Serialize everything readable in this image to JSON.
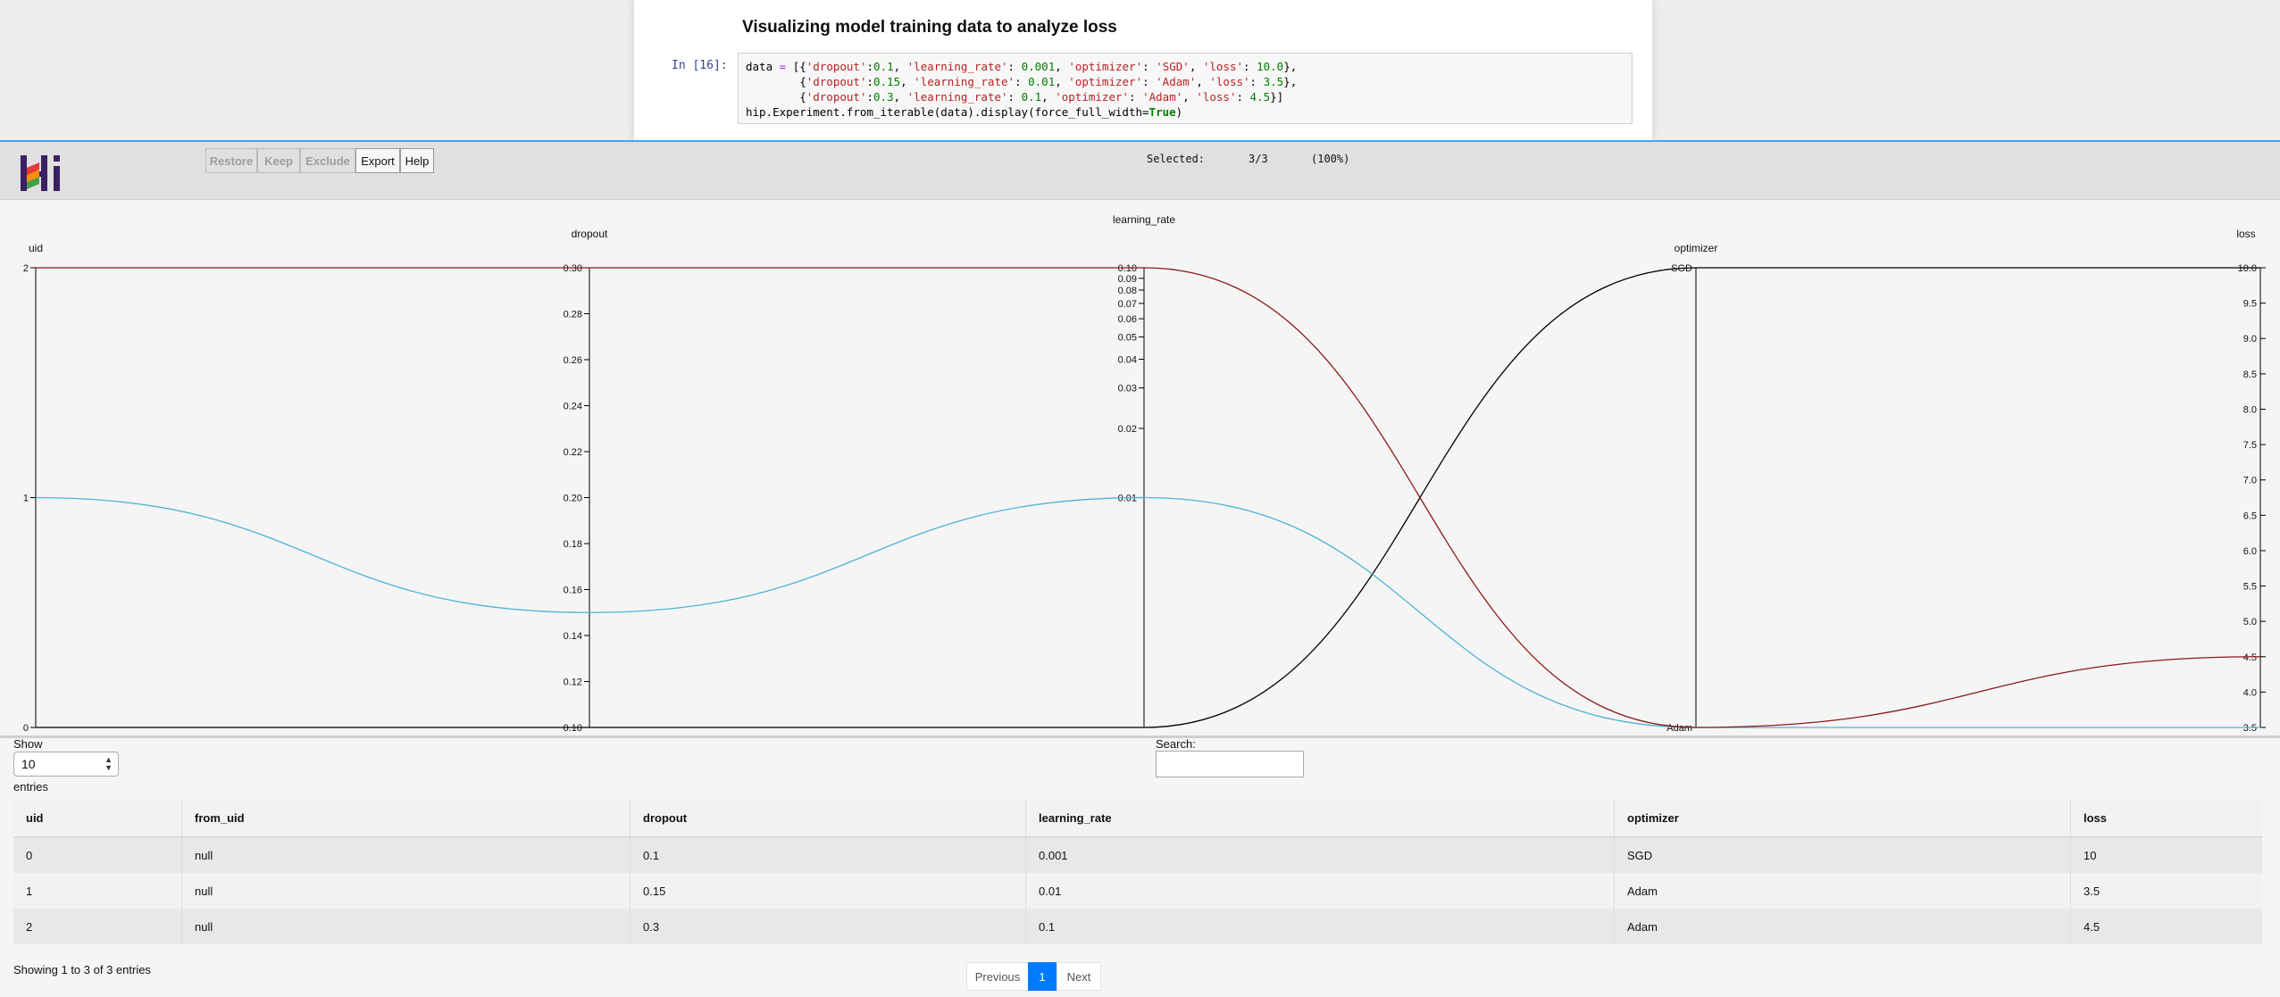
{
  "notebook": {
    "title": "Visualizing model training data to analyze loss",
    "prompt": "In [16]:",
    "code_lines": [
      "data = [{'dropout':0.1, 'learning_rate': 0.001, 'optimizer': 'SGD', 'loss': 10.0},",
      "        {'dropout':0.15, 'learning_rate': 0.01, 'optimizer': 'Adam', 'loss': 3.5},",
      "        {'dropout':0.3, 'learning_rate': 0.1, 'optimizer': 'Adam', 'loss': 4.5}]",
      "hip.Experiment.from_iterable(data).display(force_full_width=True)"
    ]
  },
  "toolbar": {
    "restore": "Restore",
    "keep": "Keep",
    "exclude": "Exclude",
    "export": "Export",
    "help": "Help",
    "selected_label": "Selected:",
    "selected_count": "3/3",
    "selected_pct": "(100%)"
  },
  "colors": {
    "accent": "#42a5f5",
    "line_sgd": "#8b1a1a",
    "line_mid": "#4fb3d6",
    "line_dark": "#000000",
    "page_button_active": "#007bff"
  },
  "chart_data": {
    "type": "parallel_coordinates",
    "axes": [
      {
        "name": "uid",
        "type": "numeric",
        "range": [
          0,
          2
        ],
        "ticks": [
          "0",
          "1",
          "2"
        ]
      },
      {
        "name": "dropout",
        "type": "numeric",
        "range": [
          0.1,
          0.3
        ],
        "ticks": [
          "0.10",
          "0.12",
          "0.14",
          "0.16",
          "0.18",
          "0.20",
          "0.22",
          "0.24",
          "0.26",
          "0.28",
          "0.30"
        ]
      },
      {
        "name": "learning_rate",
        "type": "log",
        "range": [
          0.001,
          0.1
        ],
        "ticks": [
          "0.01",
          "0.02",
          "0.03",
          "0.04",
          "0.05",
          "0.06",
          "0.07",
          "0.08",
          "0.09",
          "0.10"
        ]
      },
      {
        "name": "optimizer",
        "type": "categorical",
        "categories": [
          "Adam",
          "SGD"
        ]
      },
      {
        "name": "loss",
        "type": "numeric",
        "range": [
          3.5,
          10.0
        ],
        "ticks": [
          "3.5",
          "4.0",
          "4.5",
          "5.0",
          "5.5",
          "6.0",
          "6.5",
          "7.0",
          "7.5",
          "8.0",
          "8.5",
          "9.0",
          "9.5",
          "10.0"
        ]
      }
    ],
    "rows": [
      {
        "uid": 0,
        "dropout": 0.1,
        "learning_rate": 0.001,
        "optimizer": "SGD",
        "loss": 10.0,
        "color": "#000000"
      },
      {
        "uid": 1,
        "dropout": 0.15,
        "learning_rate": 0.01,
        "optimizer": "Adam",
        "loss": 3.5,
        "color": "#4fb3d6"
      },
      {
        "uid": 2,
        "dropout": 0.3,
        "learning_rate": 0.1,
        "optimizer": "Adam",
        "loss": 4.5,
        "color": "#8b1a1a"
      }
    ]
  },
  "table": {
    "show_label": "Show",
    "show_value": "10",
    "entries_label": "entries",
    "search_label": "Search:",
    "columns": [
      "uid",
      "from_uid",
      "dropout",
      "learning_rate",
      "optimizer",
      "loss"
    ],
    "rows": [
      [
        "0",
        "null",
        "0.1",
        "0.001",
        "SGD",
        "10"
      ],
      [
        "1",
        "null",
        "0.15",
        "0.01",
        "Adam",
        "3.5"
      ],
      [
        "2",
        "null",
        "0.3",
        "0.1",
        "Adam",
        "4.5"
      ]
    ],
    "info": "Showing 1 to 3 of 3 entries",
    "pagination": {
      "previous": "Previous",
      "page": "1",
      "next": "Next"
    }
  }
}
